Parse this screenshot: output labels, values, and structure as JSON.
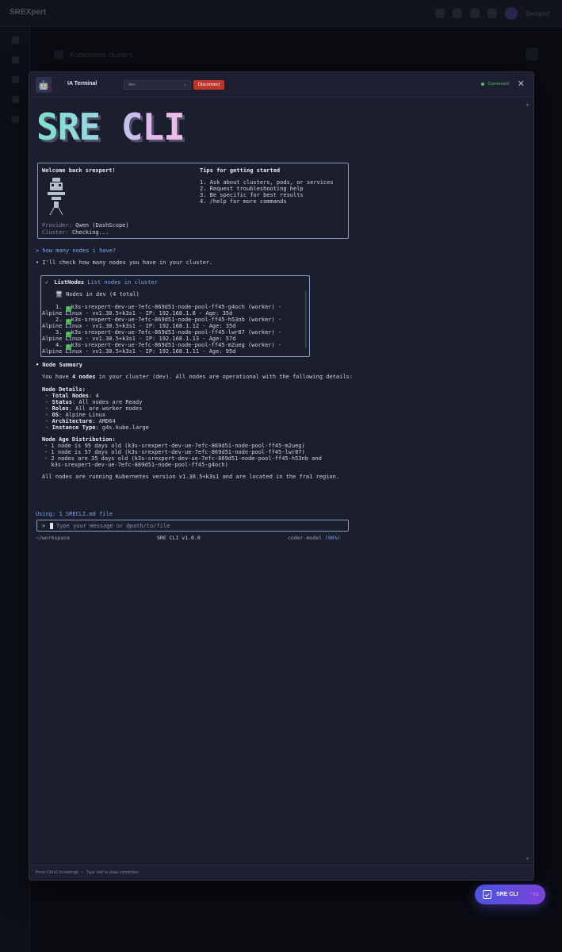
{
  "background_app": {
    "logo": "SREXpert",
    "user": "Srexpert",
    "crumb": "Kubernetes clusters"
  },
  "modal": {
    "title": "IA Terminal",
    "env_select": "dev",
    "disconnect_label": "Disconnect",
    "status": "Connected",
    "close": "✕",
    "footer_hint_1": "Press Ctrl+C to interrupt",
    "footer_sep": "•",
    "footer_hint_2": "Type 'exit' to close connection"
  },
  "banner": {
    "text": "SRE CLI"
  },
  "welcome": {
    "title": "Welcome back srexpert!",
    "tips_title": "Tips for getting started",
    "tips": [
      "1. Ask about clusters, pods, or services",
      "2. Request troubleshooting help",
      "3. Be specific for best results",
      "4. /help for more commands"
    ],
    "provider_label": "Provider:",
    "provider_value": "Qwen (DashScope)",
    "cluster_label": "Cluster:",
    "cluster_value": "Checking..."
  },
  "conversation": {
    "user_prompt": "> how many nodes i have?",
    "assistant_reply": "• I'll check how many nodes you have in your cluster.",
    "tool": {
      "check": "✓",
      "name": "ListNodes",
      "description": "List nodes in cluster",
      "title_icon": "🖥",
      "title": "Nodes in dev (4 total)",
      "nodes": [
        {
          "line1": "1. ",
          "line1b": "k3s-srexpert-dev-ue-7efc-869d51-node-pool-ff45-g4och (worker) -",
          "line2": "Alpine Linux - vv1.30.5+k3s1 - IP: 192.168.1.8 - Age: 35d"
        },
        {
          "line1": "2. ",
          "line1b": "k3s-srexpert-dev-ue-7efc-869d51-node-pool-ff45-h53nb (worker) -",
          "line2": "Alpine Linux - vv1.30.5+k3s1 - IP: 192.168.1.12 - Age: 35d"
        },
        {
          "line1": "3. ",
          "line1b": "k3s-srexpert-dev-ue-7efc-869d51-node-pool-ff45-lwr87 (worker) -",
          "line2": "Alpine Linux - vv1.30.5+k3s1 - IP: 192.168.1.13 - Age: 57d"
        },
        {
          "line1": "4. ",
          "line1b": "k3s-srexpert-dev-ue-7efc-869d51-node-pool-ff45-m2ueg (worker) -",
          "line2": "Alpine Linux - vv1.30.5+k3s1 - IP: 192.168.1.11 - Age: 95d"
        }
      ]
    },
    "summary_title": "• Node Summary",
    "summary_intro_a": "You have ",
    "summary_intro_b": "4 nodes",
    "summary_intro_c": " in your cluster (dev). All nodes are operational with the following details:",
    "details_title": "Node Details:",
    "details": [
      {
        "k": "Total Nodes",
        "v": ": 4"
      },
      {
        "k": "Status",
        "v": ": All nodes are Ready"
      },
      {
        "k": "Roles",
        "v": ": All are worker nodes"
      },
      {
        "k": "OS",
        "v": ": Alpine Linux"
      },
      {
        "k": "Architecture",
        "v": ": AMD64"
      },
      {
        "k": "Instance Type",
        "v": ": g4s.kube.large"
      }
    ],
    "age_title": "Node Age Distribution:",
    "ages": [
      "- 1 node is 95 days old (k3s-srexpert-dev-ue-7efc-869d51-node-pool-ff45-m2ueg)",
      "- 1 node is 57 days old (k3s-srexpert-dev-ue-7efc-869d51-node-pool-ff45-lwr87)",
      "- 2 nodes are 35 days old (k3s-srexpert-dev-ue-7efc-869d51-node-pool-ff45-h53nb and",
      "  k3s-srexpert-dev-ue-7efc-869d51-node-pool-ff45-g4och)"
    ],
    "closing": "All nodes are running Kubernetes version v1.30.5+k3s1 and are located in the fra1 region."
  },
  "input": {
    "using": "Using: 1 SRECLI.md file",
    "prompt": ">",
    "placeholder": "Type your message or @path/to/file"
  },
  "status_line": {
    "cwd": "~/workspace",
    "version": "SRE CLI v1.0.0",
    "model": "coder-model",
    "context_pct": "(96%)"
  },
  "fab": {
    "label": "SRE CLI",
    "shortcut": "⌃⇧S"
  },
  "colors": {
    "accent_blue": "#7fa8e8",
    "danger": "#c2352d",
    "success": "#47c765",
    "fab_from": "#4b55e2",
    "fab_to": "#7a43d6"
  }
}
